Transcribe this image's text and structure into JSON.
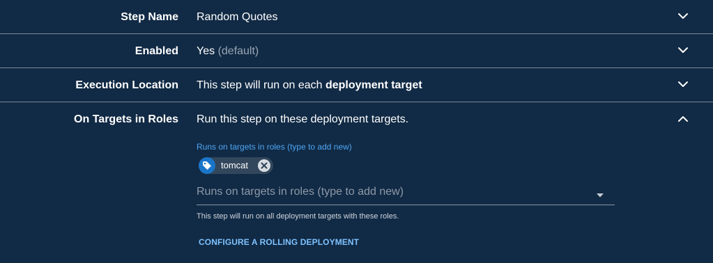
{
  "rows": {
    "step_name": {
      "label": "Step Name",
      "value": "Random Quotes"
    },
    "enabled": {
      "label": "Enabled",
      "value": "Yes",
      "suffix": "(default)"
    },
    "execution_location": {
      "label": "Execution Location",
      "value_prefix": "This step will run on each",
      "value_bold": "deployment target"
    },
    "on_targets": {
      "label": "On Targets in Roles",
      "value": "Run this step on these deployment targets."
    }
  },
  "roles": {
    "field_label": "Runs on targets in roles (type to add new)",
    "chips": [
      "tomcat"
    ],
    "placeholder": "Runs on targets in roles (type to add new)",
    "help": "This step will run on all deployment targets with these roles.",
    "rolling_link": "CONFIGURE A ROLLING DEPLOYMENT"
  },
  "icons": {
    "collapsed": "chevron-down-icon",
    "expanded": "chevron-up-icon",
    "chip": "tag-icon",
    "remove": "close-circle-icon",
    "dropdown": "caret-down-icon"
  },
  "colors": {
    "background": "#112a45",
    "accent": "#4ea7f5",
    "link": "#7ec2ff",
    "chip_icon_bg": "#1a75c9"
  }
}
